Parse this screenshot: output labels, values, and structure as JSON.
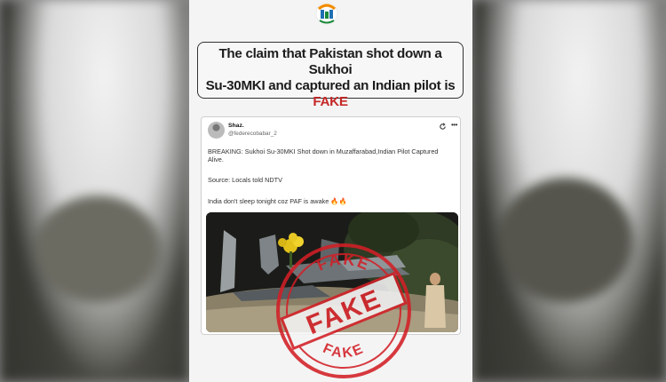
{
  "headline": {
    "line1": "The claim that Pakistan shot down a Sukhoi",
    "line2": "Su-30MKI and captured an Indian pilot is",
    "verdict": "FAKE"
  },
  "tweet": {
    "display_name": "Shaz.",
    "handle": "@federecobabar_2",
    "line_breaking": "BREAKING: Sukhoi Su-30MKI Shot down in Muzaffarabad,Indian Pilot Captured Alive.",
    "line_source": "Source: Locals told NDTV",
    "line_taunt": "India don't sleep tonight coz PAF is awake",
    "emoji": "🔥🔥"
  },
  "stamp": {
    "top_text": "FAKE",
    "center_text": "FAKE",
    "bottom_text": "FAKE"
  },
  "colors": {
    "accent": "#c62828",
    "poster_bg": "#f4f4f4"
  },
  "icons": [
    "logo-icon",
    "refresh-icon",
    "more-options-icon"
  ]
}
